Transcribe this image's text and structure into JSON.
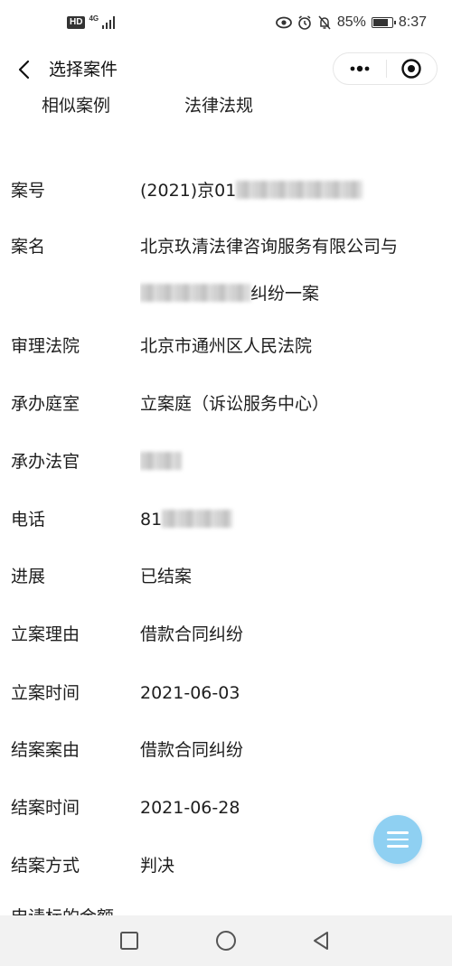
{
  "status_bar": {
    "hd": "HD",
    "network": "4G",
    "battery": "85%",
    "battery_level": 0.85,
    "time": "8:37"
  },
  "nav": {
    "title": "选择案件"
  },
  "tabs": [
    {
      "label": "相似案例"
    },
    {
      "label": "法律法规"
    }
  ],
  "details": {
    "case_no": {
      "label": "案号",
      "value": "(2021)京01"
    },
    "case_name": {
      "label": "案名",
      "value_line1": "北京玖清法律咨询服务有限公司与",
      "value_line2": "纠纷一案"
    },
    "court": {
      "label": "审理法院",
      "value": "北京市通州区人民法院"
    },
    "division": {
      "label": "承办庭室",
      "value": "立案庭（诉讼服务中心）"
    },
    "judge": {
      "label": "承办法官",
      "value": ""
    },
    "phone": {
      "label": "电话",
      "value": "81"
    },
    "progress": {
      "label": "进展",
      "value": "已结案"
    },
    "filing_reason": {
      "label": "立案理由",
      "value": "借款合同纠纷"
    },
    "filing_date": {
      "label": "立案时间",
      "value": "2021-06-03"
    },
    "closing_reason": {
      "label": "结案案由",
      "value": "借款合同纠纷"
    },
    "closing_date": {
      "label": "结案时间",
      "value": "2021-06-28"
    },
    "closing_method": {
      "label": "结案方式",
      "value": "判决"
    },
    "next_label": "申请标的金额"
  },
  "colors": {
    "fab": "#8fd0f2",
    "sys_nav": "#f2f2f2"
  },
  "icons": {
    "fab": "menu-icon",
    "back": "back-arrow-icon",
    "more": "more-dots-icon",
    "close": "target-close-icon"
  }
}
